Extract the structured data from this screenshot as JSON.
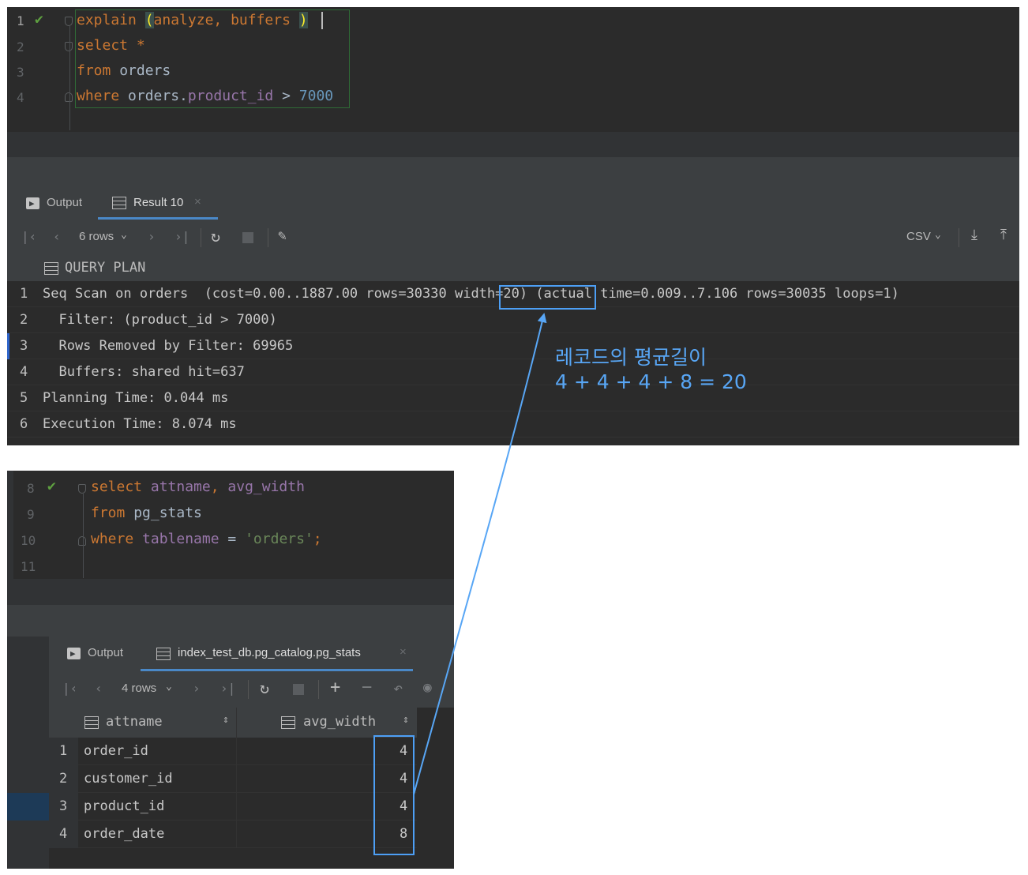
{
  "panel_a": {
    "editor": {
      "line_numbers": [
        "1",
        "2",
        "3",
        "4"
      ],
      "lines": [
        [
          {
            "t": "explain ",
            "c": "kw"
          },
          {
            "t": "(",
            "c": "paren"
          },
          {
            "t": "analyze, buffers ",
            "c": "kw"
          },
          {
            "t": ")",
            "c": "paren"
          }
        ],
        [
          {
            "t": "select ",
            "c": "kw"
          },
          {
            "t": "*",
            "c": "plain-orange"
          }
        ],
        [
          {
            "t": "from ",
            "c": "kw"
          },
          {
            "t": "orders",
            "c": "plain"
          }
        ],
        [
          {
            "t": "where ",
            "c": "kw"
          },
          {
            "t": "orders.",
            "c": "plain"
          },
          {
            "t": "product_id",
            "c": "fld"
          },
          {
            "t": " > ",
            "c": "plain"
          },
          {
            "t": "7000",
            "c": "num"
          }
        ]
      ]
    },
    "tabs": [
      {
        "label": "Output",
        "icon": "console-icon"
      },
      {
        "label": "Result 10",
        "icon": "table-icon",
        "close": "×"
      }
    ],
    "toolbar": {
      "rows_label": "6 rows",
      "format_label": "CSV"
    },
    "grid": {
      "column": "QUERY PLAN",
      "rows": [
        {
          "n": "1",
          "text": "Seq Scan on orders  (cost=0.00..1887.00 rows=30330 width=20) (actual time=0.009..7.106 rows=30035 loops=1)"
        },
        {
          "n": "2",
          "text": "  Filter: (product_id > 7000)"
        },
        {
          "n": "3",
          "text": "  Rows Removed by Filter: 69965"
        },
        {
          "n": "4",
          "text": "  Buffers: shared hit=637"
        },
        {
          "n": "5",
          "text": "Planning Time: 0.044 ms"
        },
        {
          "n": "6",
          "text": "Execution Time: 8.074 ms"
        }
      ]
    }
  },
  "annotation": {
    "line1": "레코드의 평균길이",
    "line2": "4 + 4 + 4 + 8 = 20"
  },
  "panel_b": {
    "editor": {
      "line_numbers": [
        "8",
        "9",
        "10",
        "11"
      ],
      "lines": [
        [
          {
            "t": "select ",
            "c": "kw"
          },
          {
            "t": "attname",
            "c": "fld"
          },
          {
            "t": ", ",
            "c": "kw"
          },
          {
            "t": "avg_width",
            "c": "fld"
          }
        ],
        [
          {
            "t": "from ",
            "c": "kw"
          },
          {
            "t": "pg_stats",
            "c": "plain"
          }
        ],
        [
          {
            "t": "where ",
            "c": "kw"
          },
          {
            "t": "tablename",
            "c": "fld"
          },
          {
            "t": " = ",
            "c": "plain"
          },
          {
            "t": "'orders'",
            "c": "str"
          },
          {
            "t": ";",
            "c": "kw"
          }
        ],
        []
      ]
    },
    "tabs": [
      {
        "label": "Output",
        "icon": "console-icon"
      },
      {
        "label": "index_test_db.pg_catalog.pg_stats",
        "icon": "table-icon",
        "close": "×"
      }
    ],
    "toolbar": {
      "rows_label": "4 rows"
    },
    "grid": {
      "columns": [
        "attname",
        "avg_width"
      ],
      "rows": [
        {
          "n": "1",
          "attname": "order_id",
          "avg_width": "4"
        },
        {
          "n": "2",
          "attname": "customer_id",
          "avg_width": "4"
        },
        {
          "n": "3",
          "attname": "product_id",
          "avg_width": "4"
        },
        {
          "n": "4",
          "attname": "order_date",
          "avg_width": "8"
        }
      ]
    }
  },
  "colors": {
    "keyword": "#cc7832",
    "field": "#9876aa",
    "number": "#6897bb",
    "string": "#6a8759",
    "highlight_box": "#4d9ff5",
    "annotation": "#58a6f5",
    "check": "#5ea040"
  }
}
